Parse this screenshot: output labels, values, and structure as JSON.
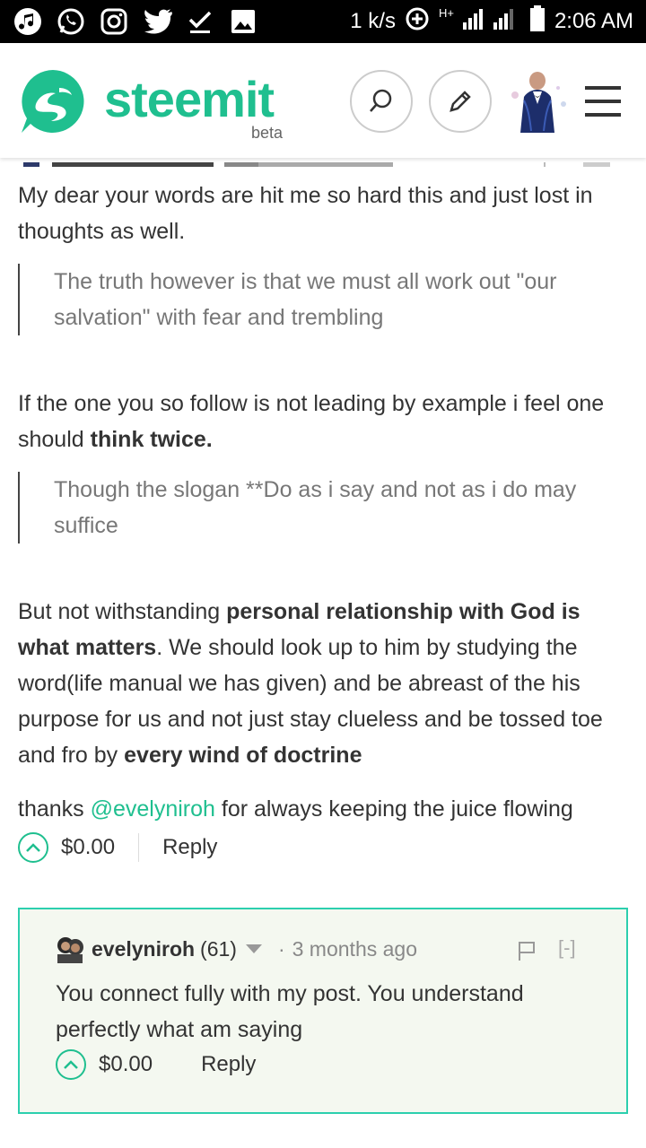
{
  "status_bar": {
    "speed": "1 k/s",
    "network": "H+",
    "time": "2:06 AM"
  },
  "header": {
    "brand": "steemit",
    "beta": "beta",
    "brand_color": "#1fbf8f"
  },
  "comment": {
    "p1": "My dear your words are hit me so hard this and just lost in thoughts as well.",
    "quote1": "The truth however is that we must all work out \"our salvation\" with fear and trembling",
    "p2_text": "If the one you so follow is not leading by example i feel one should ",
    "p2_bold": "think twice.",
    "quote2": "Though the slogan **Do as i say and not as i do may suffice",
    "p3_a": "But not withstanding ",
    "p3_bold1": "personal relationship with God is what matters",
    "p3_b": ". We should look up to him by studying the word(life manual we has given) and be abreast of the his purpose for us and not just stay clueless and be tossed toe and fro by ",
    "p3_bold2": "every wind of doctrine",
    "p4_a": "thanks ",
    "p4_mention": "@evelyniroh",
    "p4_b": " for always keeping the juice flowing",
    "payout": "$0.00",
    "reply_label": "Reply"
  },
  "reply": {
    "author": "evelyniroh",
    "reputation": "(61)",
    "dot": "·",
    "time_ago": "3 months ago",
    "collapse": "[-]",
    "body": "You connect fully with my post. You understand perfectly what am saying",
    "payout": "$0.00",
    "reply_label": "Reply",
    "border_color": "#2ccfae",
    "background": "#f4f8f0"
  }
}
